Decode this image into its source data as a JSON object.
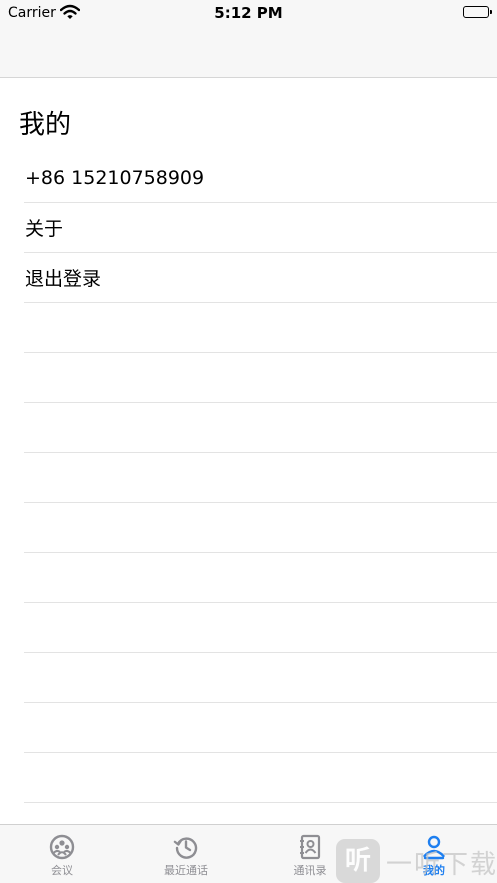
{
  "status_bar": {
    "carrier": "Carrier",
    "time": "5:12 PM"
  },
  "page": {
    "title": "我的"
  },
  "list": {
    "items": [
      {
        "label": "+86 15210758909"
      },
      {
        "label": "关于"
      },
      {
        "label": "退出登录"
      }
    ]
  },
  "tab_bar": {
    "tabs": [
      {
        "label": "会议",
        "icon": "meeting-icon",
        "active": false
      },
      {
        "label": "最近通话",
        "icon": "history-icon",
        "active": false
      },
      {
        "label": "通讯录",
        "icon": "contacts-icon",
        "active": false
      },
      {
        "label": "我的",
        "icon": "profile-icon",
        "active": true
      }
    ]
  },
  "watermark": {
    "badge": "听",
    "text": "一听下载"
  },
  "colors": {
    "accent": "#1e7ff0",
    "inactive": "#8e8e93",
    "bar_bg": "#f7f7f7"
  }
}
